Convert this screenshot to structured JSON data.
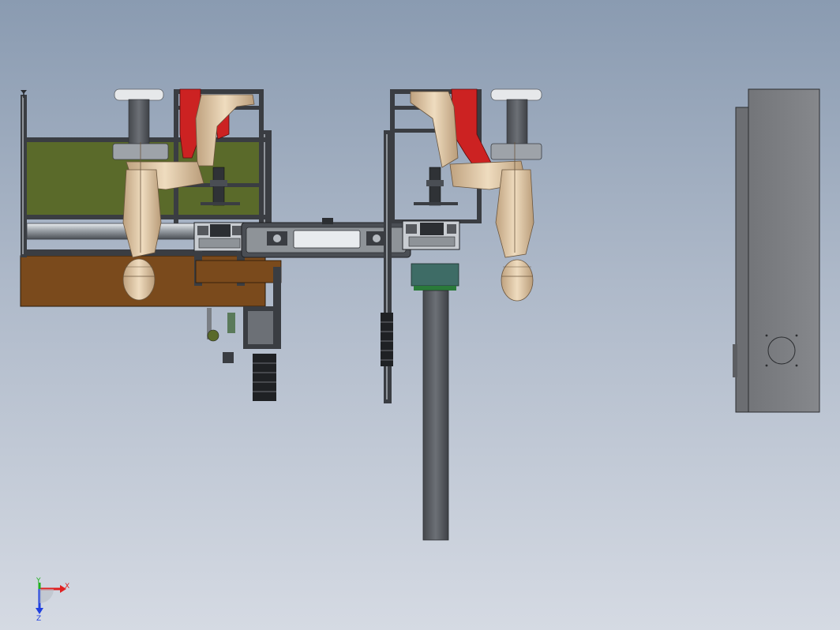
{
  "viewport": {
    "background_top": "#8a9bb1",
    "background_bottom": "#d5dae3"
  },
  "triad": {
    "x_label": "X",
    "y_label": "Y",
    "z_label": "Z",
    "x_color": "#e02020",
    "y_color": "#20b020",
    "z_color": "#2040e0"
  },
  "model": {
    "frame_color": "#3a3d42",
    "skin_color": "#e6cfae",
    "accent_color": "#cc2222",
    "panel_color": "#5a6a2a",
    "base_color": "#7a4a1c",
    "column_color": "#5c6066",
    "cabinet_color": "#7d7f83",
    "teal_color": "#3e6c66"
  }
}
